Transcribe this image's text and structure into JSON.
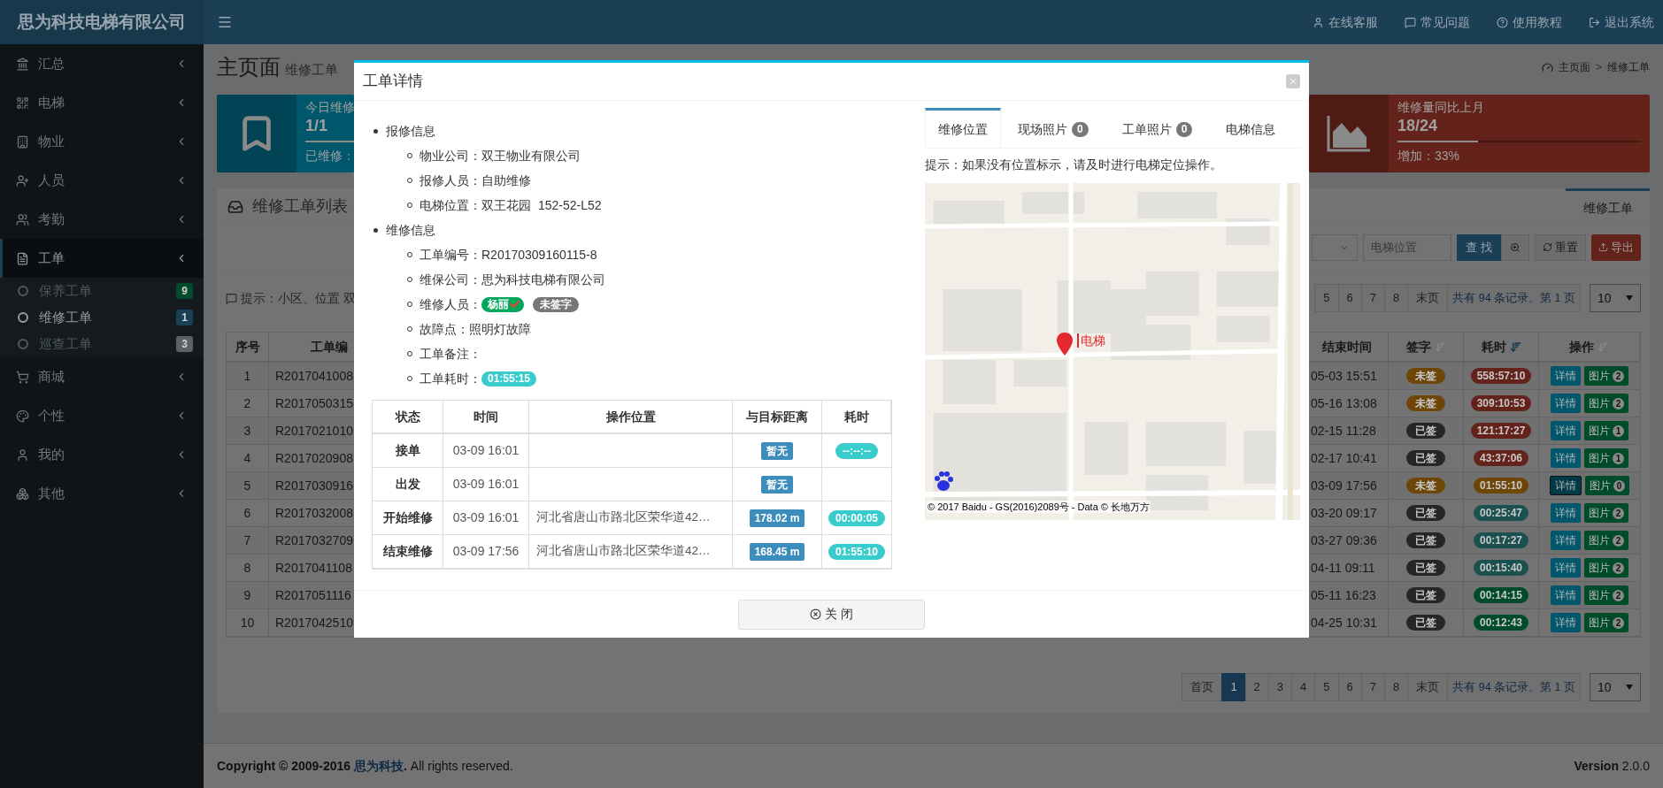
{
  "brand": "思为科技电梯有限公司",
  "top_links": [
    {
      "label": "在线客服"
    },
    {
      "label": "常见问题"
    },
    {
      "label": "使用教程"
    },
    {
      "label": "退出系统"
    }
  ],
  "sidebar": {
    "items": [
      {
        "label": "汇总",
        "expanded": false
      },
      {
        "label": "电梯",
        "expanded": false
      },
      {
        "label": "物业",
        "expanded": false
      },
      {
        "label": "人员",
        "expanded": false
      },
      {
        "label": "考勤",
        "expanded": false
      },
      {
        "label": "工单",
        "expanded": true,
        "children": [
          {
            "label": "保养工单",
            "count": "9",
            "color": "#004b29",
            "selected": false
          },
          {
            "label": "维修工单",
            "count": "1",
            "color": "#1b3f55",
            "selected": true
          },
          {
            "label": "巡查工单",
            "count": "3",
            "color": "#5e6064",
            "selected": false
          }
        ]
      },
      {
        "label": "商城",
        "expanded": false
      },
      {
        "label": "个性",
        "expanded": false
      },
      {
        "label": "我的",
        "expanded": false
      },
      {
        "label": "其他",
        "expanded": false
      }
    ]
  },
  "page_header": {
    "title": "主页面",
    "subtitle": "维修工单",
    "breadcrumb": [
      "主页面",
      "维修工单"
    ],
    "breadcrumb_separator": ">"
  },
  "stat_cards": [
    {
      "color": "#00566b",
      "label": "今日维修",
      "value": "1/1",
      "level": 1,
      "footer": "已维修："
    },
    {
      "color": "#63221a",
      "label": "维修量同比上月",
      "value": "18/24",
      "level": 0.33,
      "footer": "增加：33%"
    }
  ],
  "panel": {
    "title": "维修工单列表",
    "tabs": [
      {
        "label": "维修工单",
        "selected": true
      }
    ],
    "toolbar": {
      "location_placeholder": "电梯位置",
      "search_button": "查 找",
      "reset_button": "重置",
      "export_button": "导出"
    },
    "hint": "提示：小区、位置 双",
    "pagination_top": {
      "pages": [
        {
          "label": "5",
          "selected": false
        },
        {
          "label": "6",
          "selected": false
        },
        {
          "label": "7",
          "selected": false
        },
        {
          "label": "8",
          "selected": false
        },
        {
          "label": "末页",
          "selected": false
        }
      ],
      "summary": "共有 94 条记录。第 1 页",
      "page_size": "10"
    },
    "table": {
      "left_columns": [
        "序号",
        "工单编"
      ],
      "right_columns": [
        {
          "label": "结束时间",
          "sortable": false
        },
        {
          "label": "签字",
          "sortable": true,
          "sorted": false
        },
        {
          "label": "耗时",
          "sortable": true,
          "sorted": true
        },
        {
          "label": "操作",
          "sortable": true,
          "sorted": false
        }
      ],
      "rows": [
        {
          "index": "1",
          "order_no": "R2017041008",
          "end_time": "05-03 15:51",
          "signed": false,
          "signature": "未签",
          "duration": {
            "text": "558:57:10",
            "color": "#63221a"
          },
          "detail": "详情",
          "photos": "图片",
          "photo_count": "2",
          "selected": false
        },
        {
          "index": "2",
          "order_no": "R2017050315",
          "end_time": "05-16 13:08",
          "signed": false,
          "signature": "未签",
          "duration": {
            "text": "309:10:53",
            "color": "#63221a"
          },
          "detail": "详情",
          "photos": "图片",
          "photo_count": "2",
          "selected": false
        },
        {
          "index": "3",
          "order_no": "R2017021010",
          "end_time": "02-15 11:28",
          "signed": true,
          "signature": "已签",
          "duration": {
            "text": "121:17:27",
            "color": "#63221a"
          },
          "detail": "详情",
          "photos": "图片",
          "photo_count": "1",
          "selected": false
        },
        {
          "index": "4",
          "order_no": "R2017020908",
          "end_time": "02-17 10:41",
          "signed": true,
          "signature": "已签",
          "duration": {
            "text": "43:37:06",
            "color": "#63221a"
          },
          "detail": "详情",
          "photos": "图片",
          "photo_count": "1",
          "selected": false
        },
        {
          "index": "5",
          "order_no": "R2017030916",
          "end_time": "03-09 17:56",
          "signed": false,
          "signature": "未签",
          "duration": {
            "text": "01:55:10",
            "color": "#6d4608"
          },
          "detail": "详情",
          "photos": "图片",
          "photo_count": "0",
          "selected": true
        },
        {
          "index": "6",
          "order_no": "R2017032008",
          "end_time": "03-20 09:17",
          "signed": true,
          "signature": "已签",
          "duration": {
            "text": "00:25:47",
            "color": "#1a5050"
          },
          "detail": "详情",
          "photos": "图片",
          "photo_count": "2",
          "selected": false
        },
        {
          "index": "7",
          "order_no": "R2017032709",
          "end_time": "03-27 09:36",
          "signed": true,
          "signature": "已签",
          "duration": {
            "text": "00:17:27",
            "color": "#1a5050"
          },
          "detail": "详情",
          "photos": "图片",
          "photo_count": "2",
          "selected": false
        },
        {
          "index": "8",
          "order_no": "R2017041108",
          "end_time": "04-11 09:11",
          "signed": true,
          "signature": "已签",
          "duration": {
            "text": "00:15:40",
            "color": "#1a5050"
          },
          "detail": "详情",
          "photos": "图片",
          "photo_count": "2",
          "selected": false
        },
        {
          "index": "9",
          "order_no": "R2017051116",
          "end_time": "05-11 16:23",
          "signed": true,
          "signature": "已签",
          "duration": {
            "text": "00:14:15",
            "color": "#004b29"
          },
          "detail": "详情",
          "photos": "图片",
          "photo_count": "2",
          "selected": false
        },
        {
          "index": "10",
          "order_no": "R2017042510",
          "end_time": "04-25 10:31",
          "signed": true,
          "signature": "已签",
          "duration": {
            "text": "00:12:43",
            "color": "#004b29"
          },
          "detail": "详情",
          "photos": "图片",
          "photo_count": "2",
          "selected": false
        }
      ]
    },
    "pagination_bottom": {
      "pages": [
        {
          "label": "首页",
          "selected": false
        },
        {
          "label": "1",
          "selected": true
        },
        {
          "label": "2",
          "selected": false
        },
        {
          "label": "3",
          "selected": false
        },
        {
          "label": "4",
          "selected": false
        },
        {
          "label": "5",
          "selected": false
        },
        {
          "label": "6",
          "selected": false
        },
        {
          "label": "7",
          "selected": false
        },
        {
          "label": "8",
          "selected": false
        },
        {
          "label": "末页",
          "selected": false
        }
      ],
      "summary": "共有 94 条记录。第 1 页",
      "page_size": "10"
    }
  },
  "footer": {
    "copyright_prefix": "**Copyright © 2009-2016** ",
    "company": "思为科技",
    "copyright_suffix": "**.** All rights reserved.",
    "version": "**Version** 2.0.0"
  },
  "modal": {
    "title": "工单详情",
    "sections": [
      {
        "title": "报修信息",
        "items": [
          {
            "label": "物业公司：",
            "value": "双王物业有限公司"
          },
          {
            "label": "报修人员：",
            "value": "自助维修"
          },
          {
            "label": "电梯位置：",
            "value": "双王花园",
            "extra": "152-52-L52"
          }
        ]
      },
      {
        "title": "维修信息",
        "items": [
          {
            "label": "工单编号：",
            "value": "R20170309160115-8"
          },
          {
            "label": "维保公司：",
            "value": "思为科技电梯有限公司"
          },
          {
            "label": "维修人员：",
            "badges": [
              {
                "kind": "person",
                "text": "杨丽",
                "verified": true
              },
              {
                "kind": "status",
                "text": "未签字"
              }
            ]
          },
          {
            "label": "故障点：",
            "value": "照明灯故障"
          },
          {
            "label": "工单备注："
          },
          {
            "label": "工单耗时：",
            "badges": [
              {
                "kind": "duration",
                "text": "01:55:15"
              }
            ]
          }
        ]
      }
    ],
    "log_table": {
      "columns": [
        "状态",
        "时间",
        "操作位置",
        "与目标距离",
        "耗时"
      ],
      "rows": [
        {
          "status": "接单",
          "time": "03-09 16:01",
          "distance": "暂无",
          "duration": "--:--:--"
        },
        {
          "status": "出发",
          "time": "03-09 16:01",
          "distance": "暂无"
        },
        {
          "status": "开始维修",
          "time": "03-09 16:01",
          "location": "河北省唐山市路北区荣华道42…",
          "distance": "178.02 m",
          "duration": "00:00:05"
        },
        {
          "status": "结束维修",
          "time": "03-09 17:56",
          "location": "河北省唐山市路北区荣华道42…",
          "distance": "168.45 m",
          "duration": "01:55:10"
        }
      ]
    },
    "tabs": [
      {
        "label": "维修位置",
        "selected": true
      },
      {
        "label": "现场照片",
        "count": "0",
        "selected": false
      },
      {
        "label": "工单照片",
        "count": "0",
        "selected": false
      },
      {
        "label": "电梯信息",
        "selected": false
      }
    ],
    "map_hint": "提示：如果没有位置标示，请及时进行电梯定位操作。",
    "map": {
      "marker_label": "电梯",
      "attribution": "© 2017 Baidu - GS(2016)2089号 - Data © 长地万方"
    },
    "close_button": "关 闭"
  }
}
